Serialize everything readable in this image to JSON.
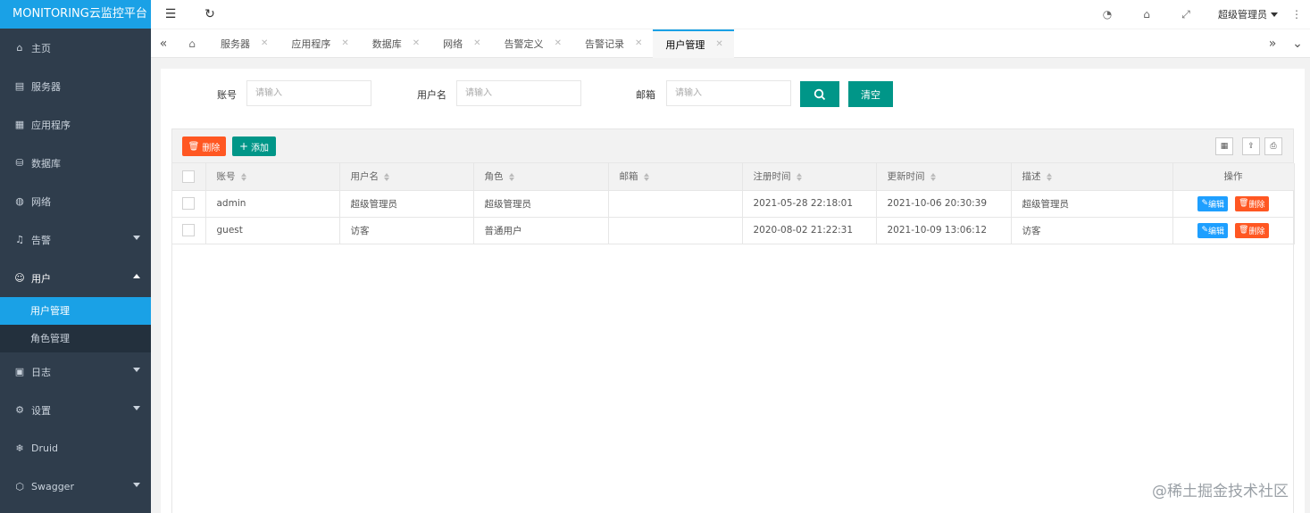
{
  "app": {
    "title": "MONITORING云监控平台"
  },
  "sidebar": {
    "items": [
      {
        "label": "主页",
        "icon": "home-icon"
      },
      {
        "label": "服务器",
        "icon": "server-icon"
      },
      {
        "label": "应用程序",
        "icon": "app-icon"
      },
      {
        "label": "数据库",
        "icon": "database-icon"
      },
      {
        "label": "网络",
        "icon": "network-icon"
      },
      {
        "label": "告警",
        "icon": "bell-icon"
      },
      {
        "label": "用户",
        "icon": "user-icon"
      },
      {
        "label": "日志",
        "icon": "log-icon"
      },
      {
        "label": "设置",
        "icon": "gear-icon"
      },
      {
        "label": "Druid",
        "icon": "snowflake-icon"
      },
      {
        "label": "Swagger",
        "icon": "cube-icon"
      }
    ],
    "submenu": [
      {
        "label": "用户管理",
        "active": true
      },
      {
        "label": "角色管理",
        "active": false
      }
    ]
  },
  "topbar": {
    "user": "超级管理员"
  },
  "tabs": [
    {
      "label": "服务器"
    },
    {
      "label": "应用程序"
    },
    {
      "label": "数据库"
    },
    {
      "label": "网络"
    },
    {
      "label": "告警定义"
    },
    {
      "label": "告警记录"
    },
    {
      "label": "用户管理",
      "active": true
    }
  ],
  "search": {
    "account_label": "账号",
    "account_placeholder": "请输入",
    "username_label": "用户名",
    "username_placeholder": "请输入",
    "email_label": "邮箱",
    "email_placeholder": "请输入",
    "clear_label": "清空"
  },
  "toolbar": {
    "delete_label": "删除",
    "add_label": "添加"
  },
  "table": {
    "columns": [
      "账号",
      "用户名",
      "角色",
      "邮箱",
      "注册时间",
      "更新时间",
      "描述",
      "操作"
    ],
    "rows": [
      [
        "admin",
        "超级管理员",
        "超级管理员",
        "",
        "2021-05-28 22:18:01",
        "2021-10-06 20:30:39",
        "超级管理员"
      ],
      [
        "guest",
        "访客",
        "普通用户",
        "",
        "2020-08-02 21:22:31",
        "2021-10-09 13:06:12",
        "访客"
      ]
    ],
    "edit_label": "编辑",
    "delete_label": "删除"
  },
  "watermark": "@稀土掘金技术社区",
  "colors": {
    "accent": "#1aa1e6",
    "sidebar": "#2f3d4c",
    "primary": "#009688",
    "danger": "#ff5722",
    "info": "#1e9fff"
  }
}
